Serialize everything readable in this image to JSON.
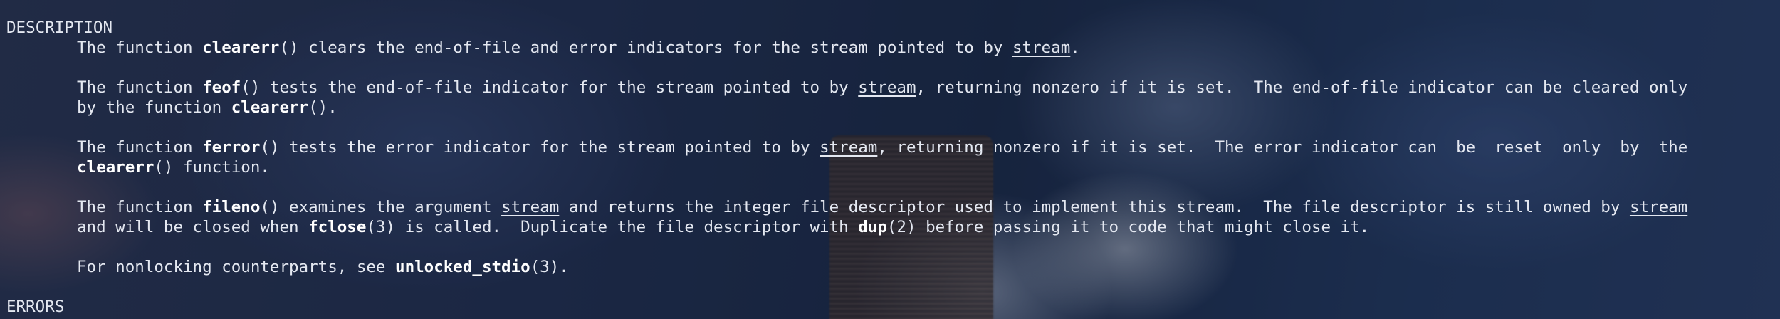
{
  "sections": {
    "description": "DESCRIPTION",
    "errors": "ERRORS"
  },
  "p1": {
    "t1": "The function ",
    "fn": "clearerr",
    "t2": "() clears the end-of-file and error indicators for the stream pointed to by ",
    "arg": "stream",
    "t3": "."
  },
  "p2": {
    "l1": {
      "t1": "The function ",
      "fn": "feof",
      "t2": "() tests the end-of-file indicator for the stream pointed to by ",
      "arg": "stream",
      "t3": ", returning nonzero if it is set.  The end-of-file indicator can be cleared only"
    },
    "l2": {
      "t1": "by the function ",
      "fn": "clearerr",
      "t2": "()."
    }
  },
  "p3": {
    "l1": {
      "t1": "The function ",
      "fn": "ferror",
      "t2": "() tests the error indicator for the stream pointed to by ",
      "arg": "stream",
      "t3": ", returning nonzero if it is set.  The error indicator can  be  reset  only  by  the"
    },
    "l2": {
      "fn": "clearerr",
      "t1": "() function."
    }
  },
  "p4": {
    "l1": {
      "t1": "The function ",
      "fn": "fileno",
      "t2": "() examines the argument ",
      "arg": "stream",
      "t3": " and returns the integer file descriptor used to implement this stream.  The file descriptor is still owned by ",
      "arg2": "stream"
    },
    "l2": {
      "t1": "and will be closed when ",
      "fn": "fclose",
      "t2": "(3) is called.  Duplicate the file descriptor with ",
      "fn2": "dup",
      "t3": "(2) before passing it to code that might close it."
    }
  },
  "p5": {
    "t1": "For nonlocking counterparts, see ",
    "fn": "unlocked_stdio",
    "t2": "(3)."
  }
}
